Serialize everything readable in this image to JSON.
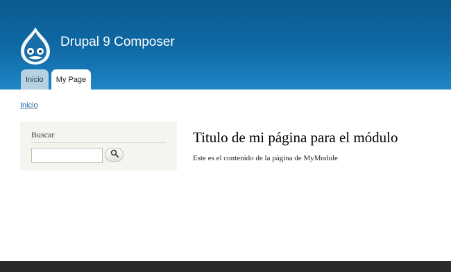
{
  "header": {
    "site_name": "Drupal 9 Composer",
    "logo_icon": "drupal-drop-icon",
    "tabs": [
      {
        "label": "Inicio",
        "active": false
      },
      {
        "label": "My Page",
        "active": true
      }
    ]
  },
  "breadcrumb": {
    "items": [
      "Inicio"
    ]
  },
  "sidebar": {
    "search_block": {
      "title": "Buscar",
      "input_value": "",
      "button_icon": "search-icon"
    }
  },
  "main": {
    "title": "Titulo de mi página para el módulo",
    "body": "Este es el contenido de la página de MyModule"
  },
  "colors": {
    "header_top": "#0b5a8e",
    "header_bottom": "#1f86c7",
    "tab_inactive": "#b7d1e3",
    "link": "#1d63a0",
    "sidebar_bg": "#f5f5f0",
    "footer": "#2b2b2b"
  }
}
